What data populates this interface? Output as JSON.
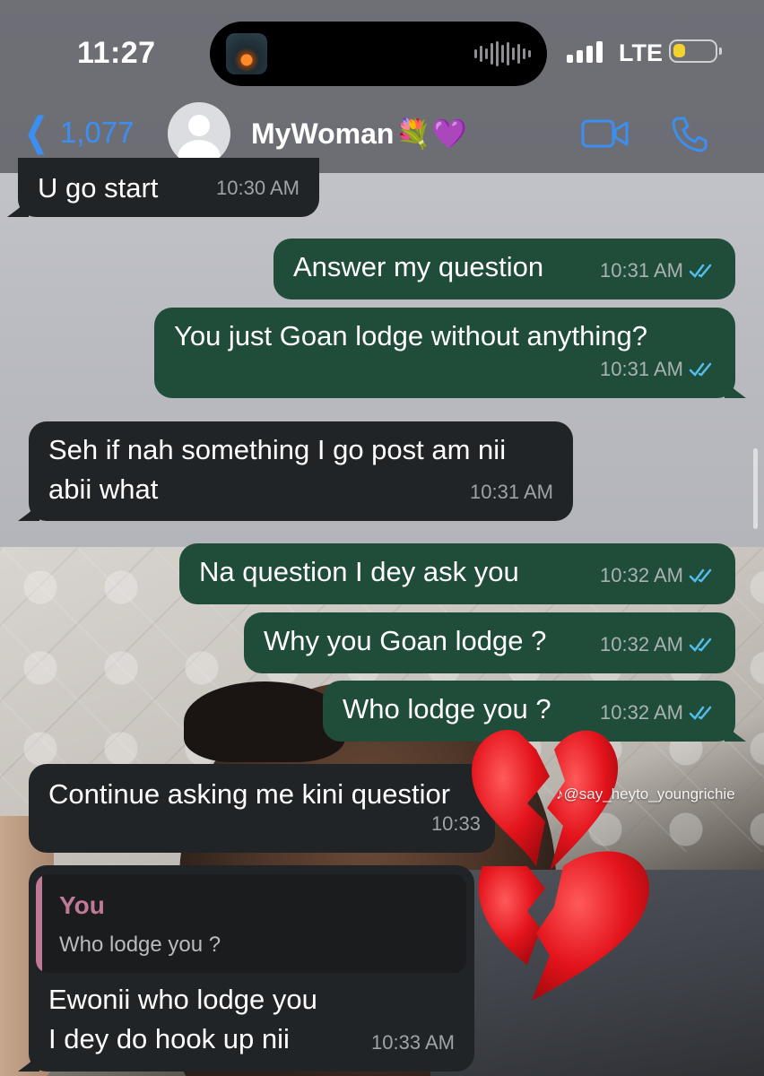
{
  "status_bar": {
    "time": "11:27",
    "network": "LTE",
    "battery_level": 0.3
  },
  "header": {
    "back_count": "1,077",
    "contact_name": "MyWoman",
    "contact_emoji": "💐💜",
    "icons": [
      "chevron-left-icon",
      "avatar-placeholder-icon",
      "video-call-icon",
      "phone-call-icon"
    ]
  },
  "colors": {
    "accent": "#3b8ff3",
    "outgoing_bubble": "#1f4d39",
    "incoming_bubble": "#212426",
    "read_ticks": "#53bdeb",
    "reply_name": "#c07a98"
  },
  "messages": [
    {
      "dir": "in",
      "text": "U go start",
      "time": "10:30 AM"
    },
    {
      "dir": "out",
      "text": "Answer my question",
      "time": "10:31 AM"
    },
    {
      "dir": "out",
      "text": "You just Goan lodge without anything?",
      "time": "10:31 AM"
    },
    {
      "dir": "in",
      "text_line1": "Seh if nah something I go post am nii",
      "text_line2": "abii what",
      "time": "10:31 AM"
    },
    {
      "dir": "out",
      "text": "Na question I dey ask you",
      "time": "10:32 AM"
    },
    {
      "dir": "out",
      "text": "Why you Goan lodge ?",
      "time": "10:32 AM"
    },
    {
      "dir": "out",
      "text": "Who lodge you ?",
      "time": "10:32 AM"
    },
    {
      "dir": "in",
      "text": "Continue asking me kini questior",
      "time": "10:33"
    },
    {
      "dir": "in",
      "reply_to_name": "You",
      "reply_to_text": "Who lodge you ?",
      "text_line1": "Ewonii who lodge you",
      "text_line2": "I dey do hook up nii",
      "time": "10:33 AM"
    }
  ],
  "watermark": "♪@say_heyto_youngrichie"
}
